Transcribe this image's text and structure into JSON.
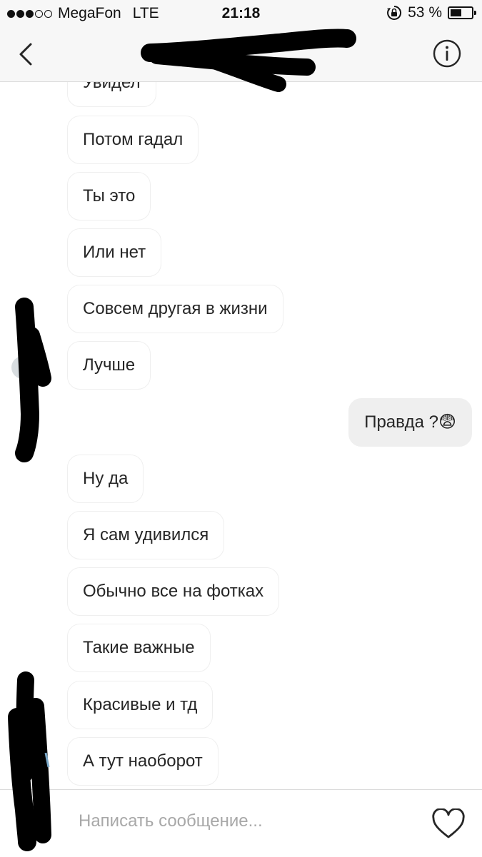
{
  "status_bar": {
    "carrier": "MegaFon",
    "network": "LTE",
    "time": "21:18",
    "battery": "53 %",
    "battery_level": 0.53,
    "signal_bars_filled": 3,
    "signal_bars_total": 5
  },
  "header": {
    "back_icon": "chevron-left-icon",
    "info_icon": "info-icon"
  },
  "messages": [
    {
      "text": "Увидел",
      "sender": "them"
    },
    {
      "text": "Потом гадал",
      "sender": "them"
    },
    {
      "text": "Ты это",
      "sender": "them"
    },
    {
      "text": "Или нет",
      "sender": "them"
    },
    {
      "text": "Совсем другая в жизни",
      "sender": "them"
    },
    {
      "text": "Лучше",
      "sender": "them"
    },
    {
      "text": "Правда ?😨",
      "sender": "me"
    },
    {
      "text": "Ну да",
      "sender": "them"
    },
    {
      "text": "Я сам удивился",
      "sender": "them"
    },
    {
      "text": "Обычно все на фотках",
      "sender": "them"
    },
    {
      "text": "Такие важные",
      "sender": "them"
    },
    {
      "text": "Красивые и тд",
      "sender": "them"
    },
    {
      "text": "А тут наоборот",
      "sender": "them"
    }
  ],
  "input": {
    "placeholder": "Написать сообщение...",
    "heart_icon": "heart-icon"
  },
  "colors": {
    "bar_background": "#f7f7f7",
    "bubble_border": "#efefef",
    "my_bubble": "#efefef",
    "text": "#262626",
    "placeholder": "#a8a8a8",
    "redaction": "#000000"
  }
}
